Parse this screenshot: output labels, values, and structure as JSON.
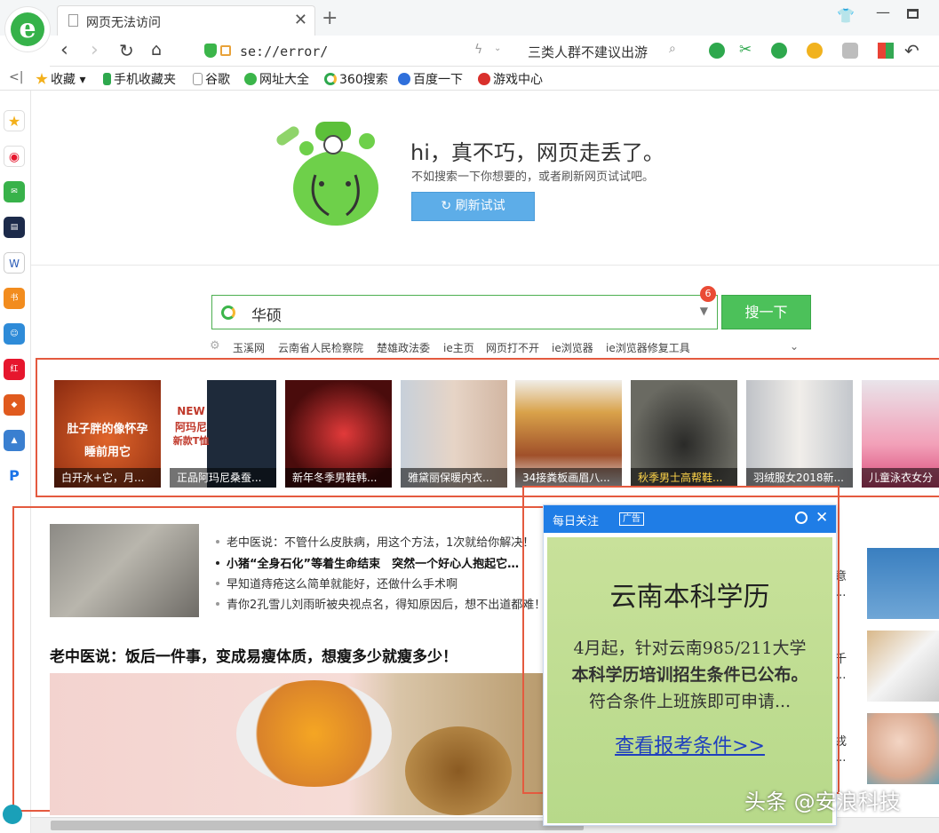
{
  "window": {
    "tab_title": "网页无法访问",
    "tab_close": "✕",
    "new_tab": "+",
    "url": "se://error/",
    "search_text": "三类人群不建议出游"
  },
  "bookmarks": [
    {
      "label": "收藏",
      "color": "#f3b01b"
    },
    {
      "label": "手机收藏夹",
      "color": "#2ea84d"
    },
    {
      "label": "谷歌",
      "color": "#9e9e9e"
    },
    {
      "label": "网址大全",
      "color": "#3bb54a"
    },
    {
      "label": "360搜索",
      "color": "#2ea84d"
    },
    {
      "label": "百度一下",
      "color": "#2f6fdb"
    },
    {
      "label": "游戏中心",
      "color": "#d9302c"
    }
  ],
  "error_page": {
    "title": "hi，真不巧，网页走丢了。",
    "subtitle": "不如搜索一下你想要的，或者刷新网页试试吧。",
    "retry_label": "刷新试试"
  },
  "search": {
    "query": "华硕",
    "badge": "6",
    "button_label": "搜一下",
    "hotwords": [
      "玉溪网",
      "云南省人民检察院",
      "楚雄政法委",
      "ie主页",
      "网页打不开",
      "ie浏览器",
      "ie浏览器修复工具"
    ]
  },
  "image_strip": [
    {
      "caption": "白开水+它，月...",
      "overlay": [
        "肚子胖的像怀孕",
        "睡前用它"
      ],
      "color": "#c8461e",
      "highlight": false
    },
    {
      "caption": "正品阿玛尼桑蚕...",
      "overlay": [
        "NEW",
        "阿玛尼",
        "新款T恤"
      ],
      "color": "#1e2a3a",
      "highlight": false
    },
    {
      "caption": "新年冬季男鞋韩...",
      "overlay": [],
      "color": "#c92a2a",
      "highlight": false
    },
    {
      "caption": "雅黛丽保暖内衣...",
      "overlay": [],
      "color": "#d9c3b4",
      "highlight": false
    },
    {
      "caption": "34接粪板画眉八...",
      "overlay": [],
      "color": "#b76a3a",
      "highlight": false
    },
    {
      "caption": "秋季男士高帮鞋...",
      "overlay": [],
      "color": "#4a4a44",
      "highlight": true
    },
    {
      "caption": "羽绒服女2018新...",
      "overlay": [],
      "color": "#e8e4df",
      "highlight": false
    },
    {
      "caption": "儿童泳衣女分",
      "overlay": [],
      "color": "#f2b6c6",
      "highlight": false
    }
  ],
  "news": {
    "items": [
      "老中医说：不管什么皮肤病，用这个方法，1次就给你解决！",
      "小猪“全身石化”等着生命结束　突然一个好心人抱起它…",
      "早知道痔疮这么简单就能好，还做什么手术啊",
      "青你2孔雪儿刘雨昕被央视点名，得知原因后，想不出道都难！"
    ],
    "headline": "老中医说：饭后一件事，变成易瘦体质，想瘦多少就瘦多少！",
    "right_snippets": [
      "意",
      "...",
      "千",
      "...",
      "戎",
      "..."
    ]
  },
  "ad": {
    "header": "每日关注",
    "tag": "广告",
    "title": "云南本科学历",
    "line1": "4月起，针对云南985/211大学",
    "line2": "本科学历培训招生条件已公布。",
    "line3": "符合条件上班族即可申请...",
    "link": "查看报考条件>>"
  },
  "watermark": "头条 @安浪科技"
}
